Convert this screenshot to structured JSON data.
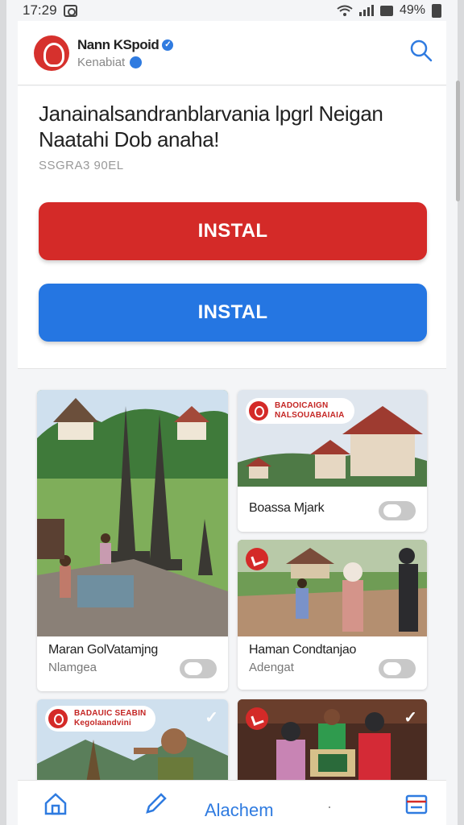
{
  "status_bar": {
    "time": "17:29",
    "battery": "49%"
  },
  "header": {
    "app_name": "Nann KSpoid",
    "subtitle": "Kenabiat"
  },
  "main": {
    "headline": "Janainalsandranblarvania lpgrl Neigan Naatahi Dob anaha!",
    "meta": "SSGRA3 90EL",
    "red_button_label": "INSTAL",
    "blue_button_label": "INSTAL"
  },
  "cards": [
    {
      "title": "Maran GolVatamjng",
      "subtitle": "Nlamgea"
    },
    {
      "badge_line1": "BADOICAIGN",
      "badge_line2": "NALSOUABAIAIA",
      "title": "Boassa Mjark"
    },
    {
      "title": "Haman Condtanjao",
      "subtitle": "Adengat"
    },
    {
      "badge_line1": "BADAUIC SEABIN",
      "badge_line2": "Kegolaandvini"
    },
    {}
  ],
  "nav": {
    "center_label": "Alachem",
    "dots": "·"
  },
  "icons": [
    "camera-icon",
    "wifi-icon",
    "signal-icon",
    "battery-icon",
    "verified-icon",
    "globe-icon",
    "search-icon",
    "home-icon",
    "pencil-icon",
    "menu-icon",
    "check-icon"
  ],
  "colors": {
    "accent_red": "#d42a28",
    "accent_blue": "#2576e2"
  }
}
